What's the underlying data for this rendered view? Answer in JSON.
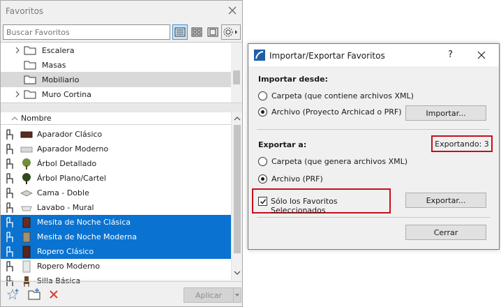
{
  "favorites": {
    "title": "Favoritos",
    "search": {
      "placeholder": "Buscar Favoritos"
    },
    "folders": [
      {
        "label": "Escalera",
        "expandable": true,
        "selected": false
      },
      {
        "label": "Masas",
        "expandable": false,
        "selected": false
      },
      {
        "label": "Mobiliario",
        "expandable": false,
        "selected": true
      },
      {
        "label": "Muro Cortina",
        "expandable": true,
        "selected": false
      }
    ],
    "column_header": "Nombre",
    "items": [
      {
        "label": "Aparador Clásico",
        "selected": false,
        "thumb": "dark-cabinet"
      },
      {
        "label": "Aparador Moderno",
        "selected": false,
        "thumb": "light-cabinet"
      },
      {
        "label": "Árbol Detallado",
        "selected": false,
        "thumb": "tree"
      },
      {
        "label": "Árbol Plano/Cartel",
        "selected": false,
        "thumb": "flat-tree"
      },
      {
        "label": "Cama - Doble",
        "selected": false,
        "thumb": "bed"
      },
      {
        "label": "Lavabo - Mural",
        "selected": false,
        "thumb": "sink"
      },
      {
        "label": "Mesita de Noche Clásica",
        "selected": true,
        "thumb": "nightstand-classic"
      },
      {
        "label": "Mesita de Noche Moderna",
        "selected": true,
        "thumb": "nightstand-modern"
      },
      {
        "label": "Ropero Clásico",
        "selected": true,
        "thumb": "wardrobe-classic"
      },
      {
        "label": "Ropero Moderno",
        "selected": false,
        "thumb": "wardrobe-modern"
      },
      {
        "label": "Silla Básica",
        "selected": false,
        "thumb": "chair"
      }
    ],
    "apply_label": "Aplicar",
    "colors": {
      "selection": "#0a73d1",
      "folder_selection": "#d9d9d9",
      "delete_icon": "#e53935"
    }
  },
  "dialog": {
    "title": "Importar/Exportar Favoritos",
    "help": "?",
    "import": {
      "heading": "Importar desde:",
      "option_folder": "Carpeta (que contiene archivos XML)",
      "option_file": "Archivo (Proyecto Archicad o PRF)",
      "selected": "file",
      "button": "Importar..."
    },
    "export": {
      "heading": "Exportar a:",
      "count_label": "Exportando: 3",
      "option_folder": "Carpeta (que genera archivos XML)",
      "option_file": "Archivo (PRF)",
      "selected": "file",
      "only_selected_label": "Sólo los Favoritos Seleccionados",
      "only_selected_checked": true,
      "button": "Exportar..."
    },
    "close_button": "Cerrar",
    "highlight_color": "#c40f1b"
  }
}
